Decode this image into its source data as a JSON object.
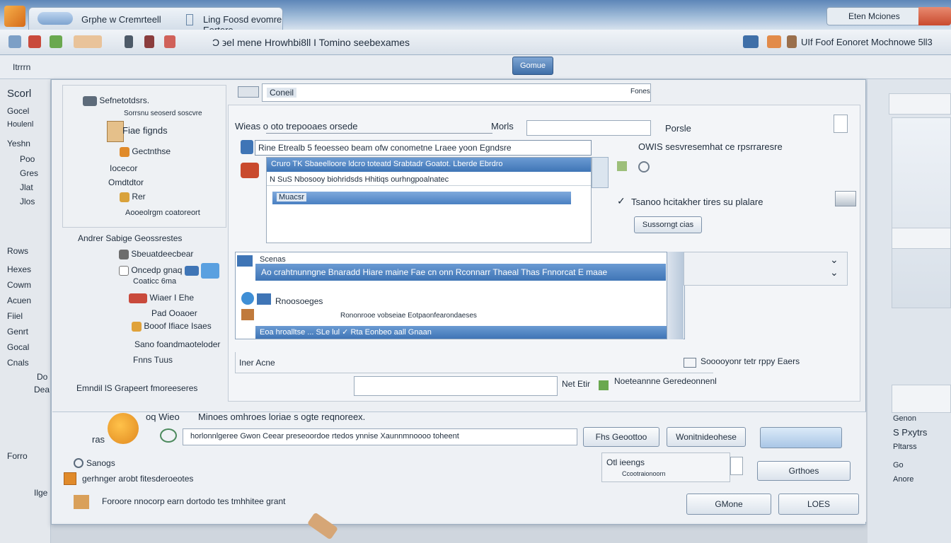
{
  "window": {
    "tab_title": "Grphe w Cremrteell",
    "tab_subtitle": "Ling Foosd evomre Eortere",
    "controls_label": "Eten Mciones"
  },
  "toolbar": {
    "center_title": "Ɔ ϶el mene  Hrowhbi8ll  I  Tomino  seebexames",
    "right_title": "UIf  Foof  Eonoret  Mochnowe  5ll3"
  },
  "menubar": {
    "label": "Itrrrn",
    "pill_button": "Gomue"
  },
  "left_rail": [
    "Scorl",
    "Gocel",
    "Houlenl",
    "Yeshn",
    "Poo",
    "Gres",
    "Jlat",
    "Jlos",
    "Rows",
    "Hexes",
    "Cowm",
    "Acuen",
    "Fiiel",
    "Genrt",
    "Gocal",
    "Cnals",
    "Do",
    "Dea",
    "Forro",
    "Ilge"
  ],
  "tree": {
    "header": "Sefnetotdsrs.",
    "sub": "Sorrsnu seoserd soscvre",
    "items": [
      "Fiae fignds",
      "Gectnthse",
      "Iocecor",
      "Omdtdtor",
      "Rer",
      "Aooeolrgm coatoreort"
    ],
    "section2": "Andrer  Sabige Geossrestes",
    "items2": [
      "Sbeuatdeecbear",
      "Oncedp gnaq",
      "Coaticc 6ma",
      "Wiaer I Ehe",
      "Pad Ooaoer",
      "Booof Ifiace Isaes",
      "Sano foandmaoteloder",
      "Fnns Tuus"
    ],
    "footer": "Emndil lS Grapeert fmoreeseres"
  },
  "content": {
    "search_value": "Coneil",
    "search_tag": "Fones",
    "row1_label": "Wieas  o  oto trepooaes orsede",
    "row1_mid": "Morls",
    "row1_right": "Porsle",
    "row2_label": "Rine  Etrealb  5 feoesseo beam   ofw  conometne  Lraee  yoon  Egndsre",
    "row2_right": "OWIS sesvresemhat ce rpsrraresre",
    "list1_selected": "Cruro  TK  Sbaeelloore  ldcro toteatd  Srabtadr Goatot. Lberde Ebrdro",
    "list1_row2": "N  SuS Nbosooy  biohridsds Hhitiqs ourhngpoalnatec",
    "list1_row3": "Muacsr",
    "row3_right": "Tsanoo hcitakher tires su plalare",
    "row3_button": "Sussorngt cias",
    "list2_header": "Scenas",
    "list2_selected": "Ao crahtnunngne  Bnaradd  Hiare  maine  Fae  cn  onn  Rconnarr  Thaeal  Thas  Fnnorcat  E maae",
    "list2_row2": "Rnoosoeges",
    "list2_row3": "Rononrooe   vobseiae   Eotpaonfearondaeses",
    "list2_row4": "Eoa  hroalltse  ...  SLe  lul  ✓  Rta  Eonbeo aall Gnaan",
    "footer_left": "Iner Acne",
    "footer_field_label": "Net Etir",
    "footer_right_label": "Sooooyonr tetr rppy  Eaers",
    "footer_right_value": "Noeteannne Geredeonnenl"
  },
  "footer": {
    "note_top": "Minoes omhroes loriae s ogte reqnoreex.",
    "label_left": "oq Wieo",
    "label_left2": "ras",
    "input_value": "horlonnlgeree  Gwon  Ceear  preseoordoe  rtedos  ynnise  Xaunnmnoooo  toheent",
    "btn_a": "Fhs  Geoottoo",
    "btn_b": "Wonitnideohese",
    "checks_label": "Sanogs",
    "check1": "gerhnger  arobt  fitesderoeotes",
    "check2": "Foroore  nnocorp  earn  dortodo tes  tmhhitee  grant",
    "group_label": "Otl ieengs",
    "group_sub": "Ccootraionoorn",
    "btn_c": "Grthoes",
    "ok_button": "GMone",
    "cancel_button": "LOES"
  },
  "right_rail": {
    "texts": [
      "Genon",
      "S Pxytrs",
      "Pltarss",
      "Go",
      "Anore"
    ]
  },
  "colors": {
    "accent": "#3f75b6",
    "selection": "#4a80c2",
    "chrome": "#5d86b8"
  }
}
